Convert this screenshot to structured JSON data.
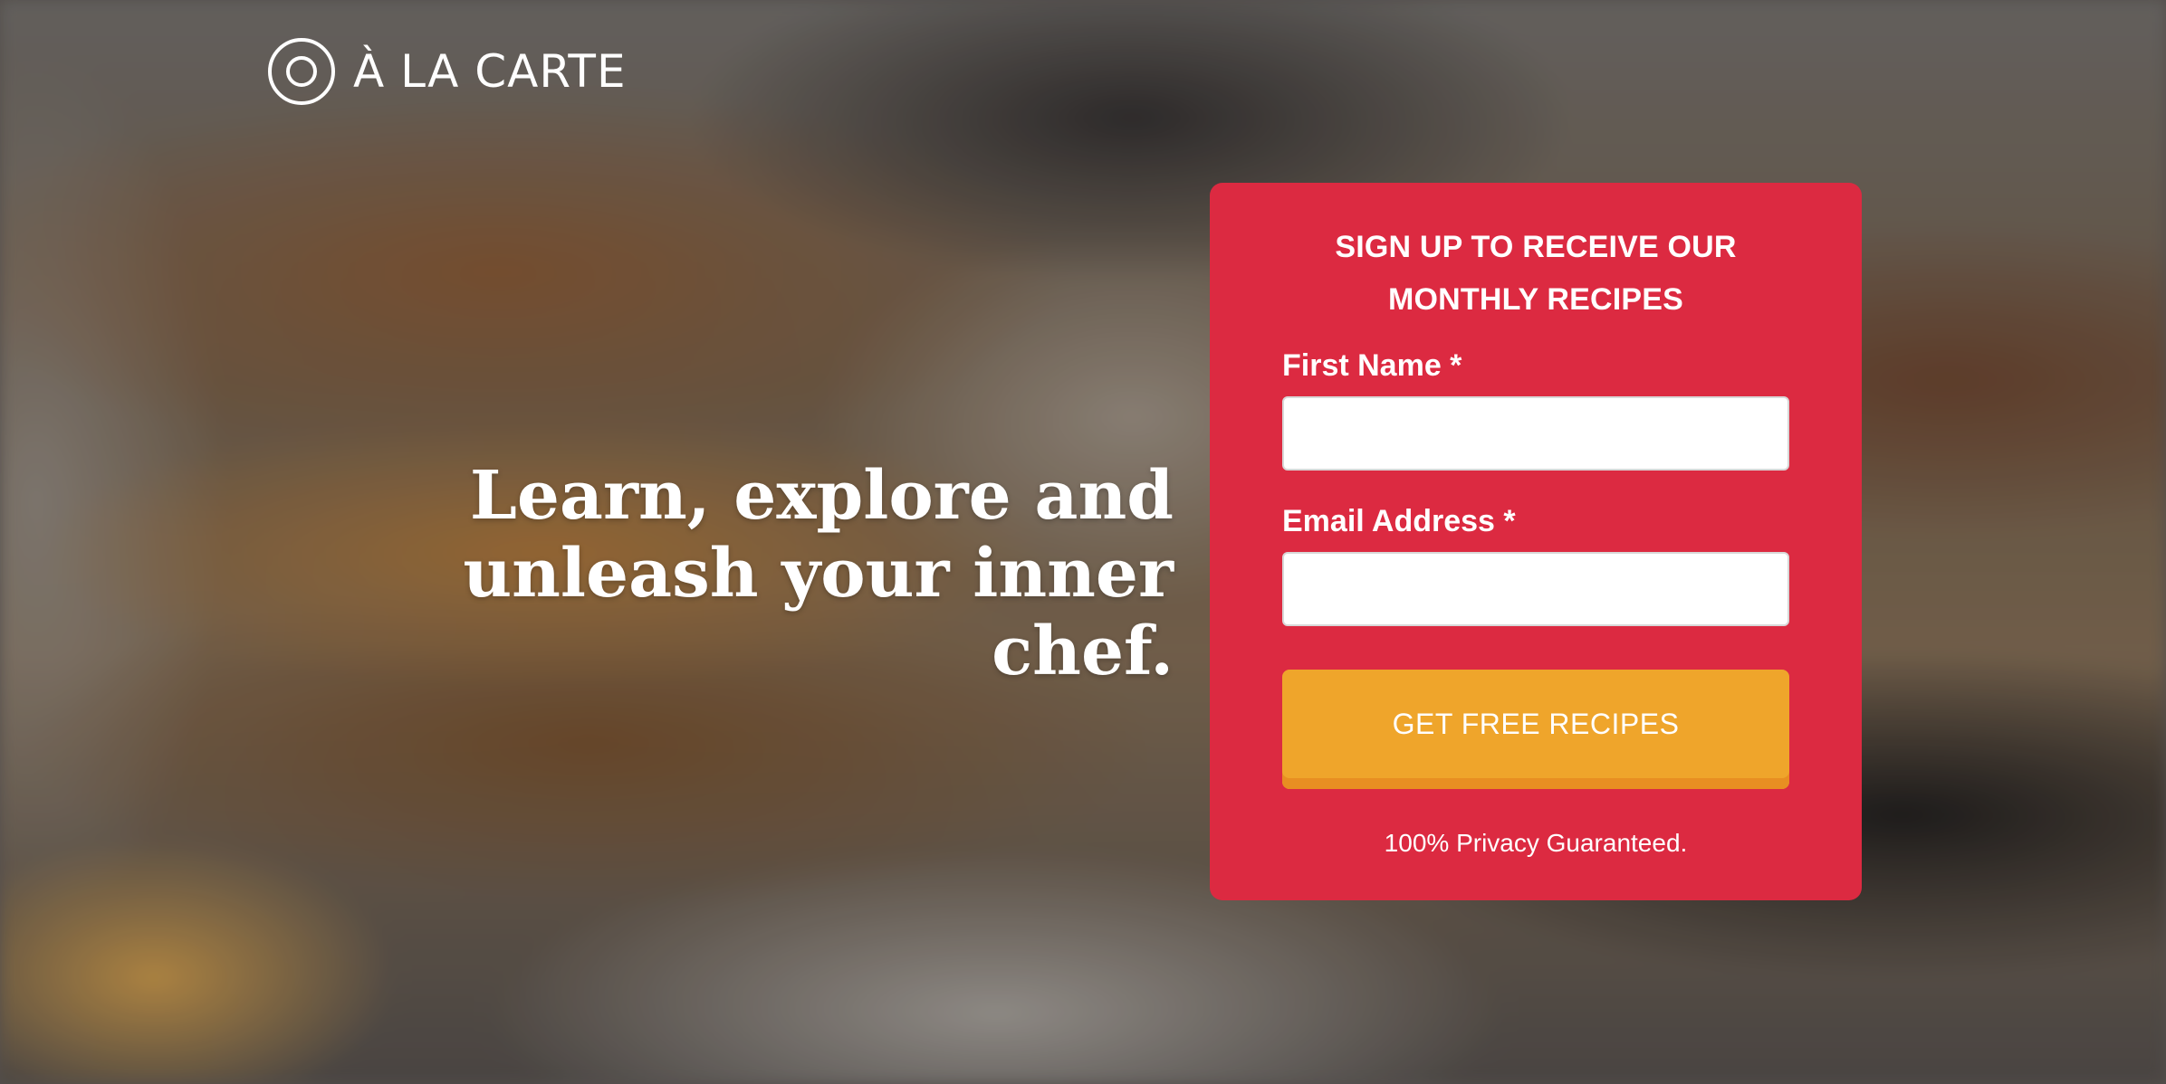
{
  "brand": {
    "name": "À LA CARTE",
    "logo_icon": "concentric-circles-icon"
  },
  "hero": {
    "headline": "Learn, explore and unleash your inner chef."
  },
  "signup": {
    "title": "SIGN UP TO RECEIVE OUR MONTHLY RECIPES",
    "first_name_label": "First Name *",
    "first_name_value": "",
    "email_label": "Email Address *",
    "email_value": "",
    "submit_label": "GET FREE RECIPES",
    "privacy_note": "100% Privacy Guaranteed."
  },
  "colors": {
    "card": "#dc2a41",
    "button": "#efa52b",
    "button_shadow": "#e88e22",
    "text": "#ffffff"
  }
}
